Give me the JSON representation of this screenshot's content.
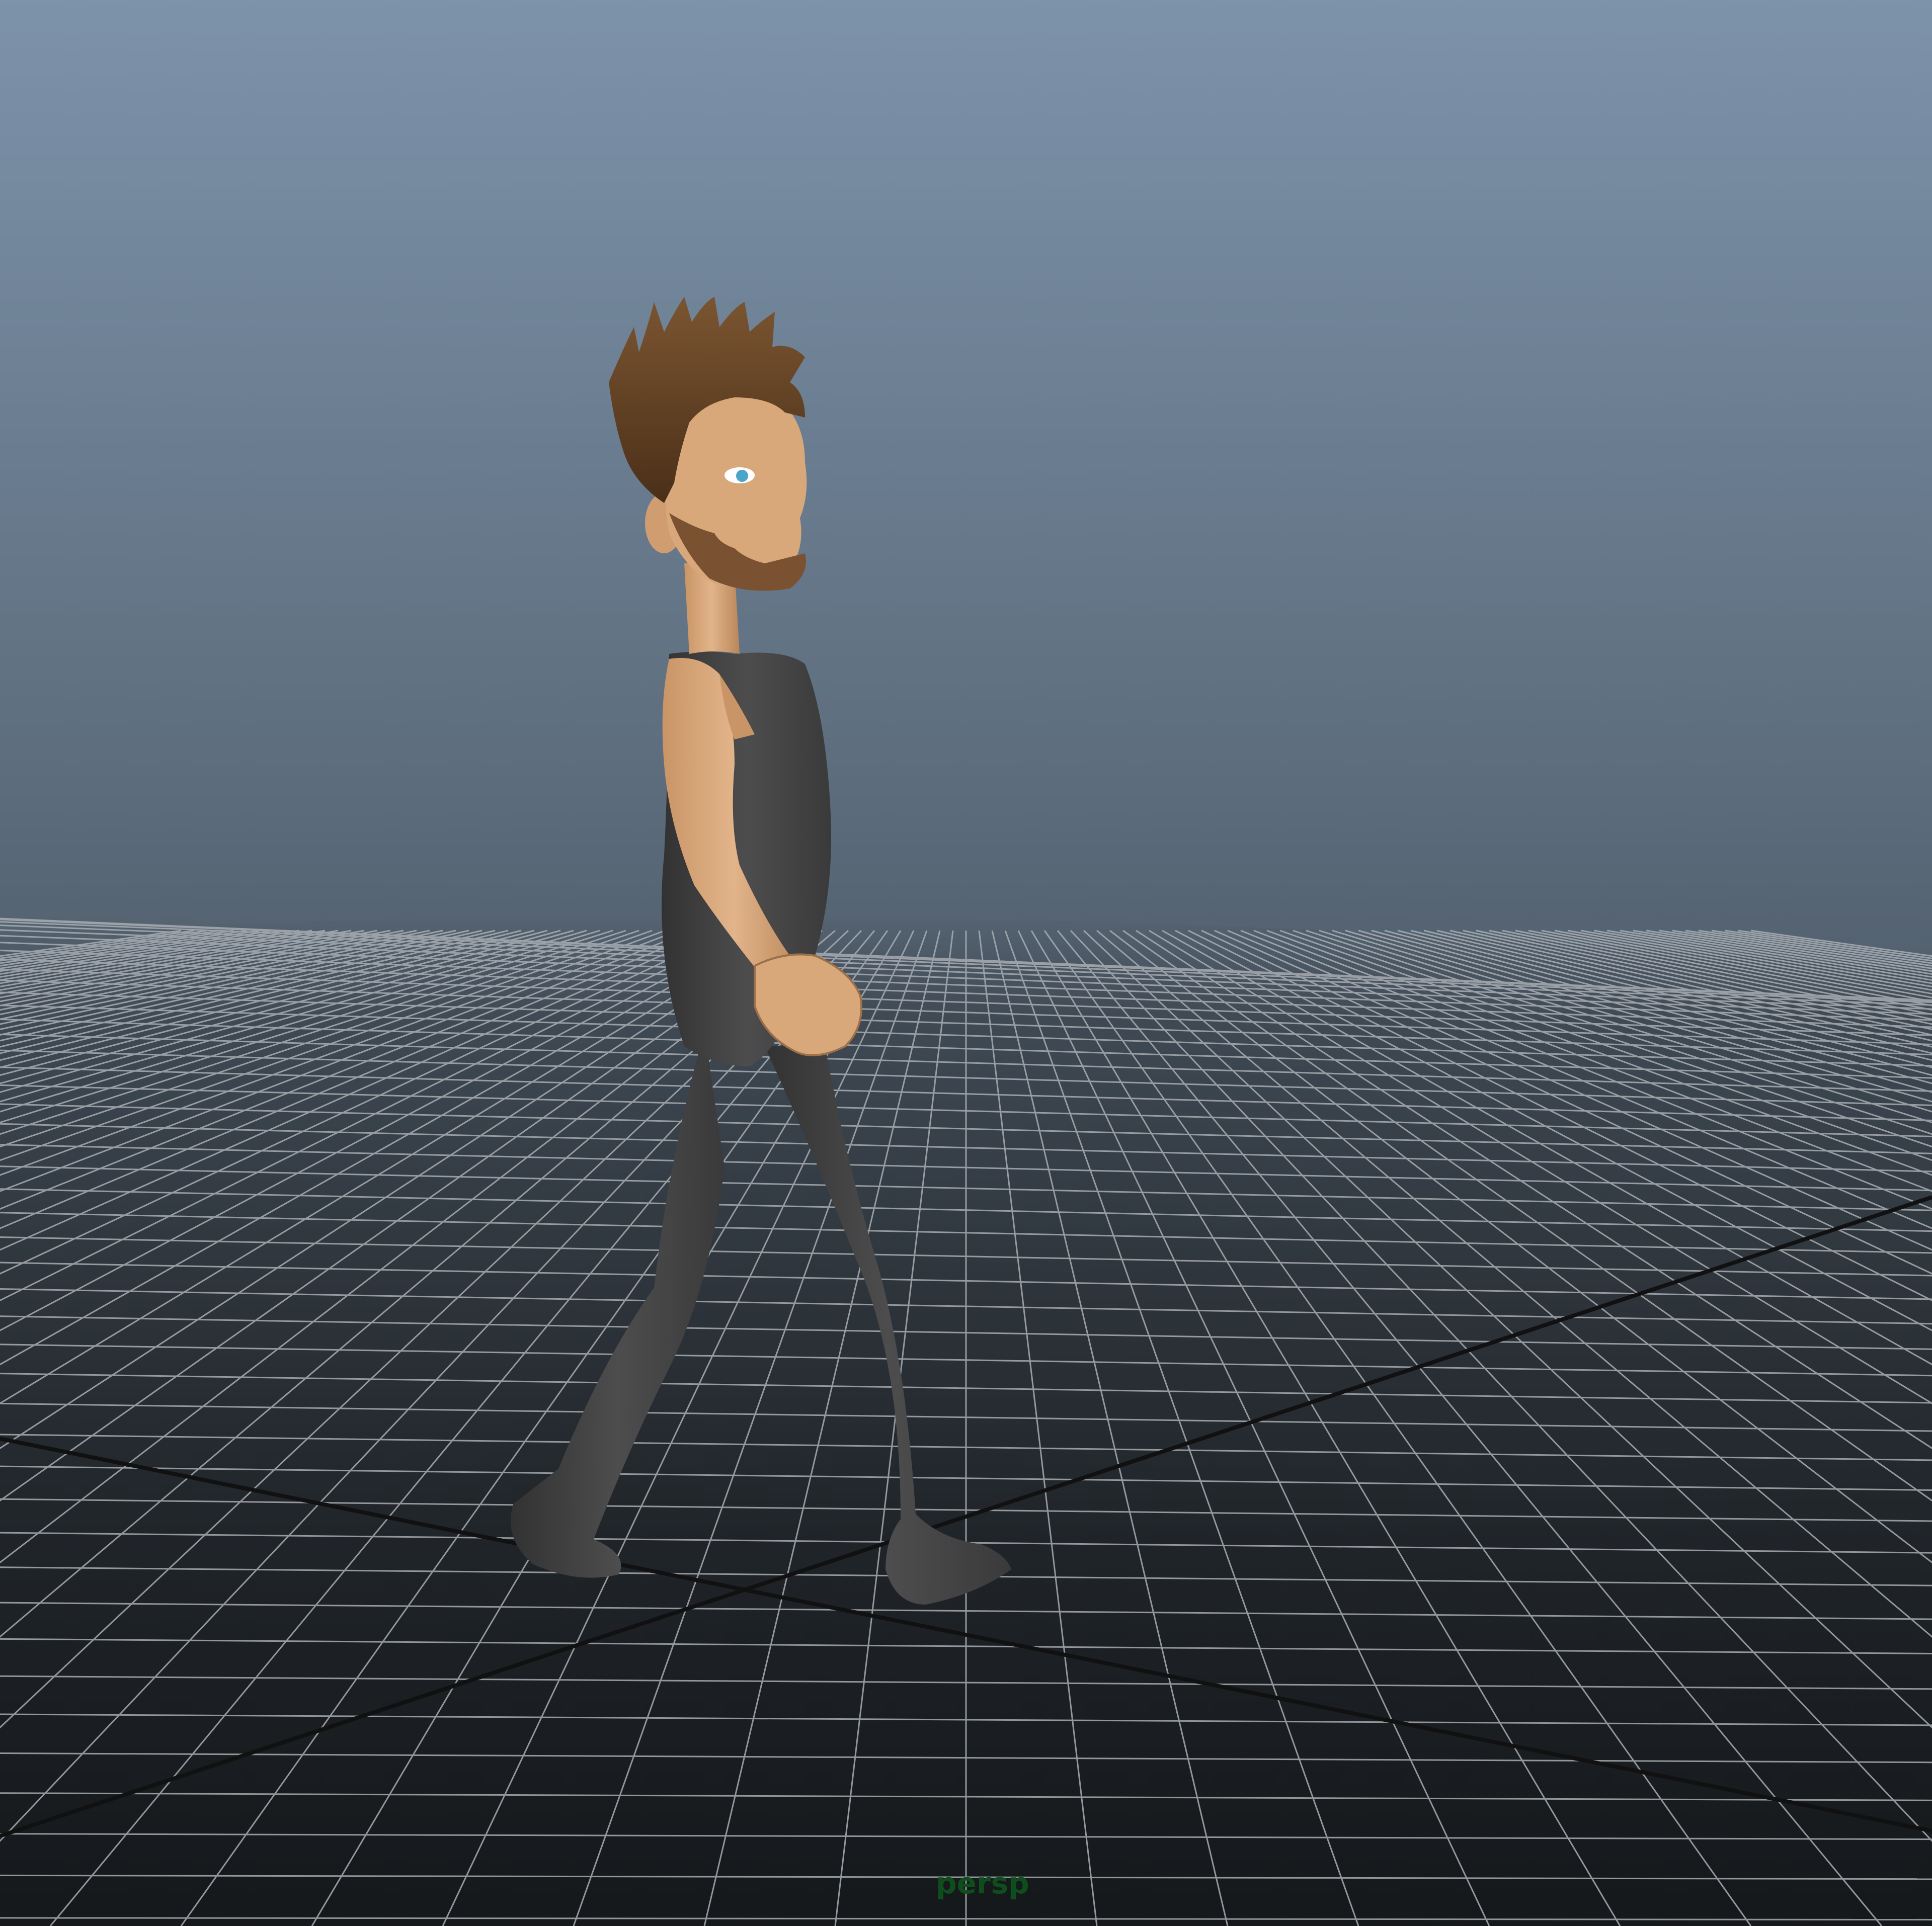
{
  "viewport": {
    "camera_name": "persp"
  },
  "scene": {
    "background_top": "#7d93aa",
    "background_bottom": "#1b1e21",
    "grid_color": "#a8adb2",
    "axis_color": "#111111",
    "character": {
      "skin_color": "#d9a87a",
      "suit_color": "#4a4a4b",
      "hair_color": "#6b4423",
      "beard_color": "#7a5232"
    }
  }
}
